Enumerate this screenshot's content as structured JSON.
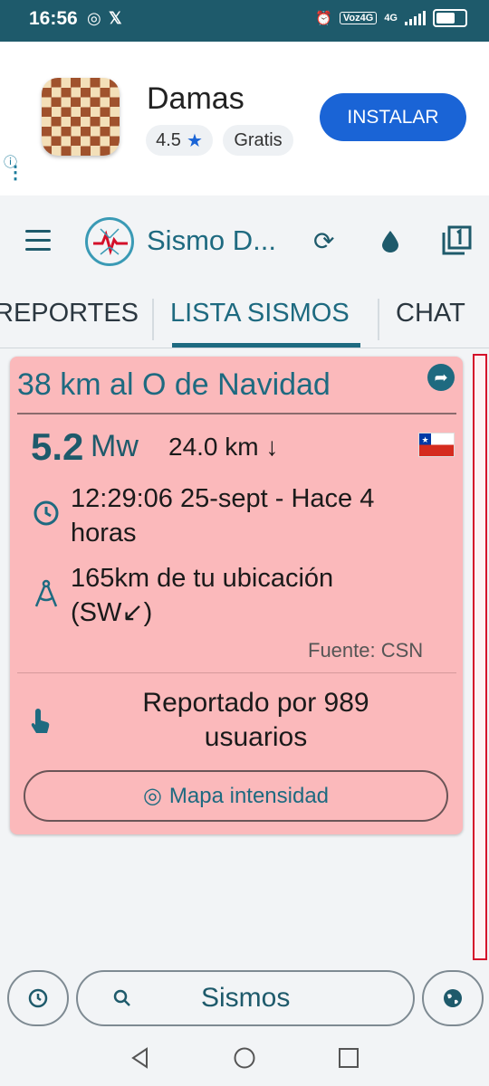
{
  "status_bar": {
    "time": "16:56",
    "network_tag": "Voz4G",
    "network_type": "4G"
  },
  "ad": {
    "app_name": "Damas",
    "rating": "4.5",
    "price": "Gratis",
    "install_label": "INSTALAR"
  },
  "toolbar": {
    "title": "Sismo D..."
  },
  "tabs": [
    {
      "label": "REPORTES"
    },
    {
      "label": "LISTA SISMOS"
    },
    {
      "label": "CHAT"
    }
  ],
  "quake": {
    "location": "38 km al O de Navidad",
    "magnitude": "5.2",
    "magnitude_unit": "Mw",
    "depth": "24.0 km ↓",
    "time_line1": "12:29:06 25-sept - Hace 4",
    "time_line2": "horas",
    "distance_line1": "165km de tu ubicación",
    "distance_line2": "(SW↙)",
    "source": "Fuente: CSN",
    "reported_line1": "Reportado por 989",
    "reported_line2": "usuarios",
    "map_button": "Mapa intensidad"
  },
  "bottom_bar": {
    "search_label": "Sismos"
  },
  "colors": {
    "accent": "#1e6a80",
    "card_bg": "#fbb9bb",
    "install": "#1a64d6",
    "status_bar": "#1e5a6b"
  }
}
